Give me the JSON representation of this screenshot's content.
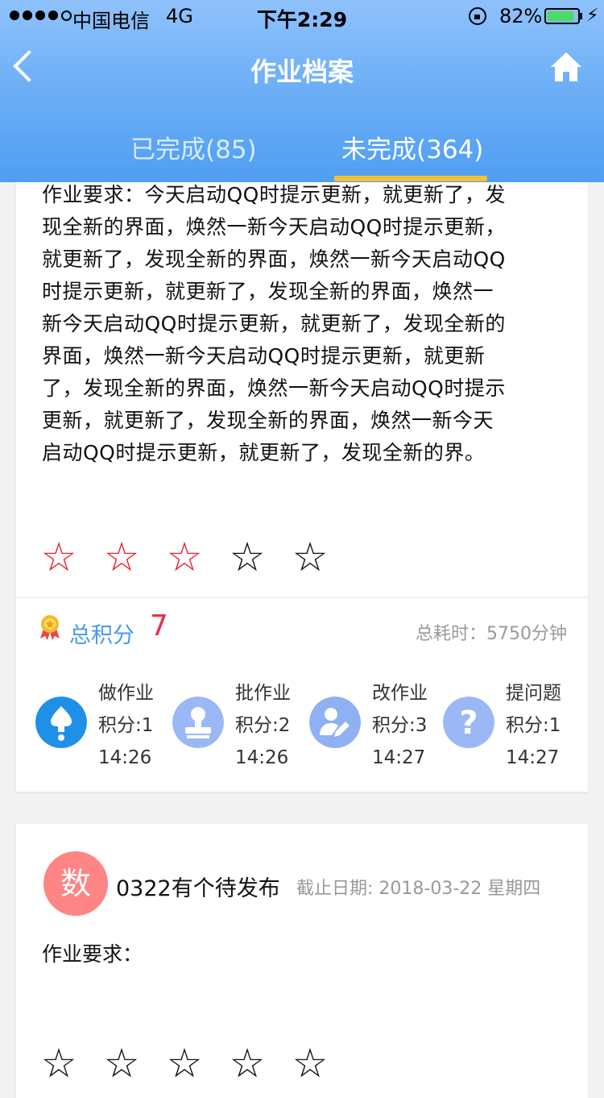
{
  "status_bar": {
    "carrier": "中国电信",
    "network": "4G",
    "time": "下午2:29",
    "battery": "82%"
  },
  "nav": {
    "title": "作业档案",
    "back_icon": "chevron-left-icon",
    "home_icon": "home-icon"
  },
  "tabs": [
    {
      "label": "已完成(85)",
      "active": false
    },
    {
      "label": "未完成(364)",
      "active": true
    }
  ],
  "colors": {
    "header": "#6fb0f7",
    "tab_indicator": "#f5c232",
    "star_on": "#e8232b",
    "total_value": "#e8314a",
    "total_label": "#4a98ec"
  },
  "card1": {
    "description_lines": [
      "作业要求：今天启动QQ时提示更新，就更新了，发",
      "现全新的界面，焕然一新今天启动QQ时提示更新，",
      "就更新了，发现全新的界面，焕然一新今天启动QQ",
      "时提示更新，就更新了，发现全新的界面，焕然一",
      "新今天启动QQ时提示更新，就更新了，发现全新的",
      "界面，焕然一新今天启动QQ时提示更新，就更新",
      "了，发现全新的界面，焕然一新今天启动QQ时提示",
      "更新，就更新了，发现全新的界面，焕然一新今天",
      "启动QQ时提示更新，就更新了，发现全新的界。"
    ],
    "rating": 3,
    "rating_max": 5,
    "total_label": "总积分",
    "total_value": "7",
    "duration": "总耗时：5750分钟",
    "actions": [
      {
        "title": "做作业",
        "score": "积分:1",
        "time": "14:26",
        "icon": "upload-icon",
        "color": "#1e90e8"
      },
      {
        "title": "批作业",
        "score": "积分:2",
        "time": "14:26",
        "icon": "stamp-icon",
        "color": "#9bb8f6"
      },
      {
        "title": "改作业",
        "score": "积分:3",
        "time": "14:27",
        "icon": "edit-user-icon",
        "color": "#8fb0f2"
      },
      {
        "title": "提问题",
        "score": "积分:1",
        "time": "14:27",
        "icon": "question-icon",
        "color": "#9bb8f6"
      }
    ]
  },
  "card2": {
    "avatar": "数",
    "title": "0322有个待发布",
    "deadline": "截止日期: 2018-03-22 星期四",
    "requirement": "作业要求：",
    "rating": 0,
    "rating_max": 5
  }
}
